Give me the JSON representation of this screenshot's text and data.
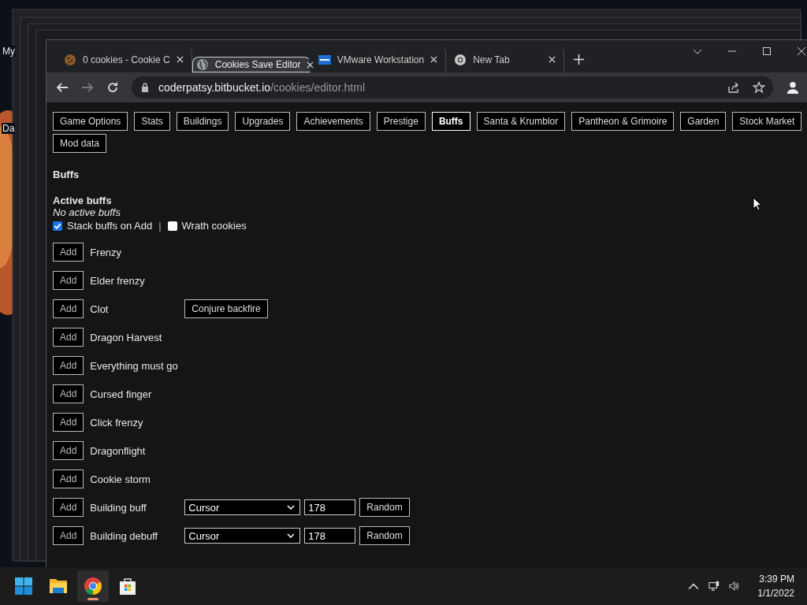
{
  "desktop": {
    "icons": [
      {
        "label": "My"
      },
      {
        "label": "Da"
      }
    ]
  },
  "browser": {
    "tabs": [
      {
        "title": "0 cookies - Cookie C",
        "selected": false
      },
      {
        "title": "Cookies Save Editor",
        "selected": true
      },
      {
        "title": "VMware Workstation",
        "selected": false
      },
      {
        "title": "New Tab",
        "selected": false
      }
    ],
    "back_disabled": false,
    "forward_disabled": true,
    "address": {
      "host": "coderpatsy.bitbucket.io",
      "path": "/cookies/editor.html"
    }
  },
  "page": {
    "nav": [
      {
        "label": "Game Options",
        "selected": false
      },
      {
        "label": "Stats",
        "selected": false
      },
      {
        "label": "Buildings",
        "selected": false
      },
      {
        "label": "Upgrades",
        "selected": false
      },
      {
        "label": "Achievements",
        "selected": false
      },
      {
        "label": "Prestige",
        "selected": false
      },
      {
        "label": "Buffs",
        "selected": true
      },
      {
        "label": "Santa & Krumblor",
        "selected": false
      },
      {
        "label": "Pantheon & Grimoire",
        "selected": false
      },
      {
        "label": "Garden",
        "selected": false
      },
      {
        "label": "Stock Market",
        "selected": false
      },
      {
        "label": "Mod data",
        "selected": false
      }
    ],
    "heading": "Buffs",
    "subheading": "Active buffs",
    "empty_note": "No active buffs",
    "options": [
      {
        "label": "Stack buffs on Add",
        "checked": true
      },
      {
        "label": "Wrath cookies",
        "checked": false
      }
    ],
    "separator": "|",
    "buffs": [
      {
        "kind": "plain",
        "button": "Add",
        "name": "Frenzy"
      },
      {
        "kind": "plain",
        "button": "Add",
        "name": "Elder frenzy"
      },
      {
        "kind": "action",
        "button": "Add",
        "name": "Clot",
        "action": "Conjure backfire"
      },
      {
        "kind": "plain",
        "button": "Add",
        "name": "Dragon Harvest"
      },
      {
        "kind": "plain",
        "button": "Add",
        "name": "Everything must go"
      },
      {
        "kind": "plain",
        "button": "Add",
        "name": "Cursed finger"
      },
      {
        "kind": "plain",
        "button": "Add",
        "name": "Click frenzy"
      },
      {
        "kind": "plain",
        "button": "Add",
        "name": "Dragonflight"
      },
      {
        "kind": "plain",
        "button": "Add",
        "name": "Cookie storm"
      },
      {
        "kind": "building",
        "button": "Add",
        "name": "Building buff",
        "building": "Cursor",
        "amount": "178",
        "random": "Random"
      },
      {
        "kind": "building",
        "button": "Add",
        "name": "Building debuff",
        "building": "Cursor",
        "amount": "178",
        "random": "Random"
      }
    ]
  },
  "taskbar": {
    "apps": [
      {
        "kind": "start",
        "selected": false
      },
      {
        "kind": "files",
        "selected": false
      },
      {
        "kind": "chrome",
        "selected": true
      },
      {
        "kind": "store",
        "selected": false
      }
    ],
    "time": "3:39 PM",
    "date": "1/1/2022"
  }
}
